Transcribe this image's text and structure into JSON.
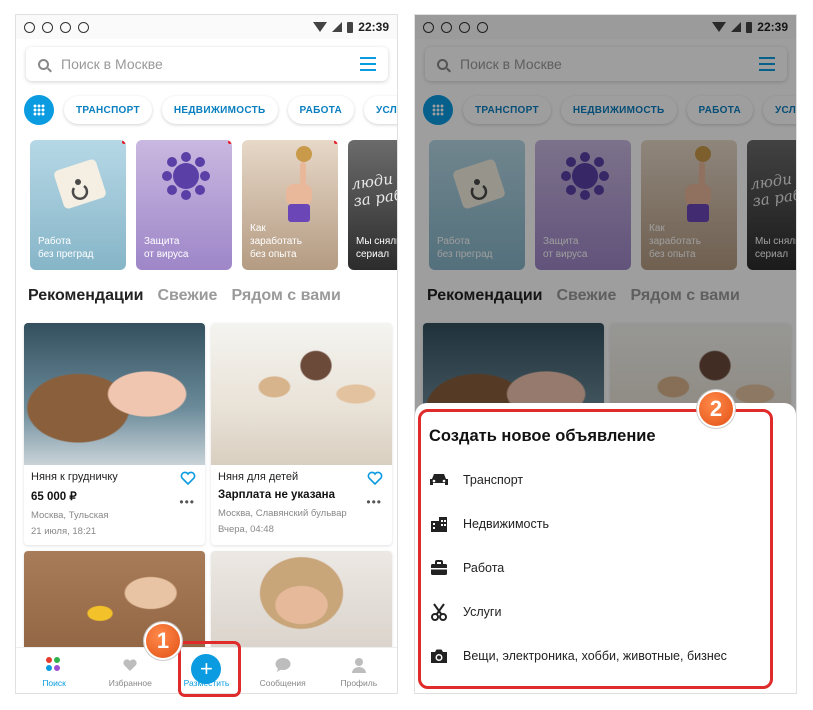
{
  "status_bar": {
    "time": "22:39"
  },
  "search": {
    "placeholder": "Поиск в Москве"
  },
  "categories": [
    "ТРАНСПОРТ",
    "НЕДВИЖИМОСТЬ",
    "РАБОТА",
    "УСЛУ"
  ],
  "stories": [
    {
      "label": "Работа\nбез преград"
    },
    {
      "label": "Защита\nот вируса"
    },
    {
      "label": "Как\nзаработать\nбез опыта"
    },
    {
      "label": "Мы сняли\nсериал",
      "art_text": "люди\nза работой"
    }
  ],
  "tabs": [
    "Рекомендации",
    "Свежие",
    "Рядом с вами"
  ],
  "listings": [
    {
      "title": "Няня к грудничку",
      "price": "65 000 ₽",
      "location": "Москва, Тульская",
      "date": "21 июля, 18:21"
    },
    {
      "title": "Няня для детей",
      "price": "Зарплата не указана",
      "location": "Москва, Славянский бульвар",
      "date": "Вчера, 04:48"
    }
  ],
  "bottom_nav": [
    {
      "label": "Поиск"
    },
    {
      "label": "Избранное"
    },
    {
      "label": "Разместить"
    },
    {
      "label": "Сообщения"
    },
    {
      "label": "Профиль"
    }
  ],
  "sheet": {
    "title": "Создать новое объявление",
    "options": [
      {
        "label": "Транспорт",
        "icon": "car-icon"
      },
      {
        "label": "Недвижимость",
        "icon": "building-icon"
      },
      {
        "label": "Работа",
        "icon": "briefcase-icon"
      },
      {
        "label": "Услуги",
        "icon": "scissors-icon"
      },
      {
        "label": "Вещи, электроника, хобби, животные, бизнес",
        "icon": "camera-icon"
      }
    ]
  },
  "annotations": {
    "step1": "1",
    "step2": "2"
  },
  "colors": {
    "accent": "#0a9be0",
    "highlight": "#e02b2b",
    "badge": "#e25016"
  }
}
